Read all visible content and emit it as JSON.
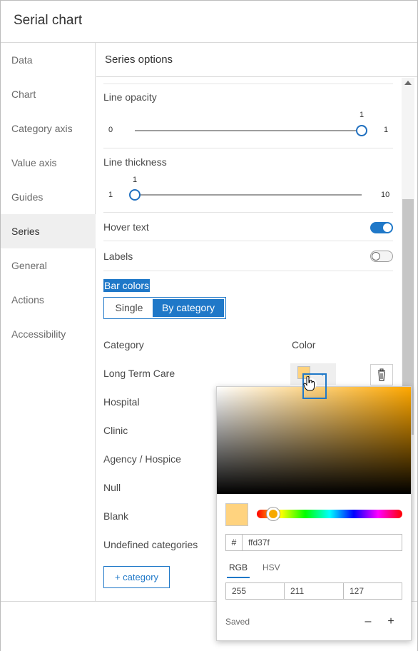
{
  "window": {
    "title": "Serial chart"
  },
  "nav": {
    "items": [
      {
        "label": "Data",
        "active": false
      },
      {
        "label": "Chart",
        "active": false
      },
      {
        "label": "Category axis",
        "active": false
      },
      {
        "label": "Value axis",
        "active": false
      },
      {
        "label": "Guides",
        "active": false
      },
      {
        "label": "Series",
        "active": true
      },
      {
        "label": "General",
        "active": false
      },
      {
        "label": "Actions",
        "active": false
      },
      {
        "label": "Accessibility",
        "active": false
      }
    ]
  },
  "panel": {
    "title": "Series options",
    "line_opacity": {
      "label": "Line opacity",
      "min": "0",
      "max": "1",
      "value": "1",
      "level": 1.0
    },
    "line_thickness": {
      "label": "Line thickness",
      "min": "1",
      "max": "10",
      "value": "1",
      "level": 0.0
    },
    "hover_text": {
      "label": "Hover text",
      "on": true
    },
    "labels": {
      "label": "Labels",
      "on": false
    },
    "bar_colors": {
      "label": "Bar colors",
      "options": [
        "Single",
        "By category"
      ],
      "selected": "By category"
    },
    "category_table": {
      "col_category": "Category",
      "col_color": "Color",
      "rows": [
        "Long Term Care",
        "Hospital",
        "Clinic",
        "Agency / Hospice",
        "Null",
        "Blank",
        "Undefined categories"
      ],
      "first_color": "#ffd37f"
    },
    "add_category_label": "+ category"
  },
  "color_picker": {
    "hue_color": "#ffa800",
    "hex_prefix": "#",
    "hex_value": "ffd37f",
    "tabs": [
      "RGB",
      "HSV"
    ],
    "active_tab": "RGB",
    "rgb": {
      "r": "255",
      "g": "211",
      "b": "127"
    },
    "saved_label": "Saved",
    "minus": "–",
    "plus": "+"
  },
  "colors": {
    "accent": "#1f78c8",
    "selected_color": "#ffd37f"
  }
}
